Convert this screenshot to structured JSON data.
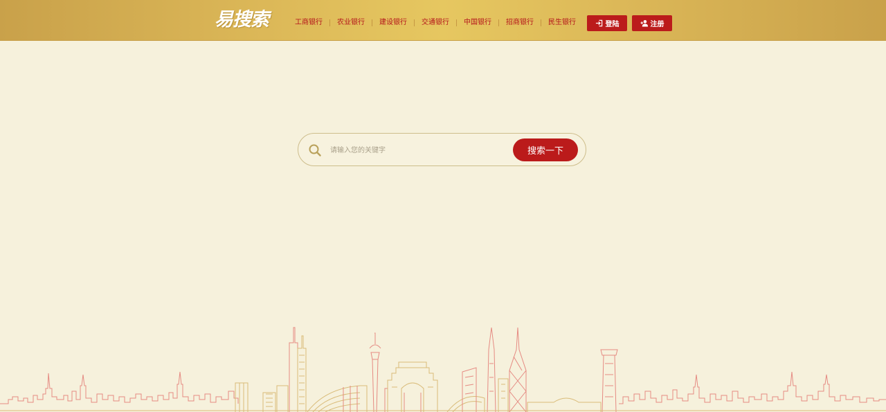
{
  "header": {
    "logo_text": "易搜索",
    "nav": [
      {
        "label": "工商银行"
      },
      {
        "label": "农业银行"
      },
      {
        "label": "建设银行"
      },
      {
        "label": "交通银行"
      },
      {
        "label": "中国银行"
      },
      {
        "label": "招商银行"
      },
      {
        "label": "民生银行"
      }
    ],
    "login_label": "登陆",
    "register_label": "注册"
  },
  "search": {
    "placeholder": "请输入您的关键字",
    "value": "",
    "button_label": "搜索一下"
  },
  "colors": {
    "header_gold": "#dcb858",
    "accent_red": "#bb1b1b",
    "page_background": "#f6f1dc",
    "skyline_red": "#e58a82",
    "skyline_gold": "#d9bb78"
  },
  "icons": {
    "login": "login-arrow-icon",
    "register": "add-user-icon",
    "search": "search-icon"
  }
}
